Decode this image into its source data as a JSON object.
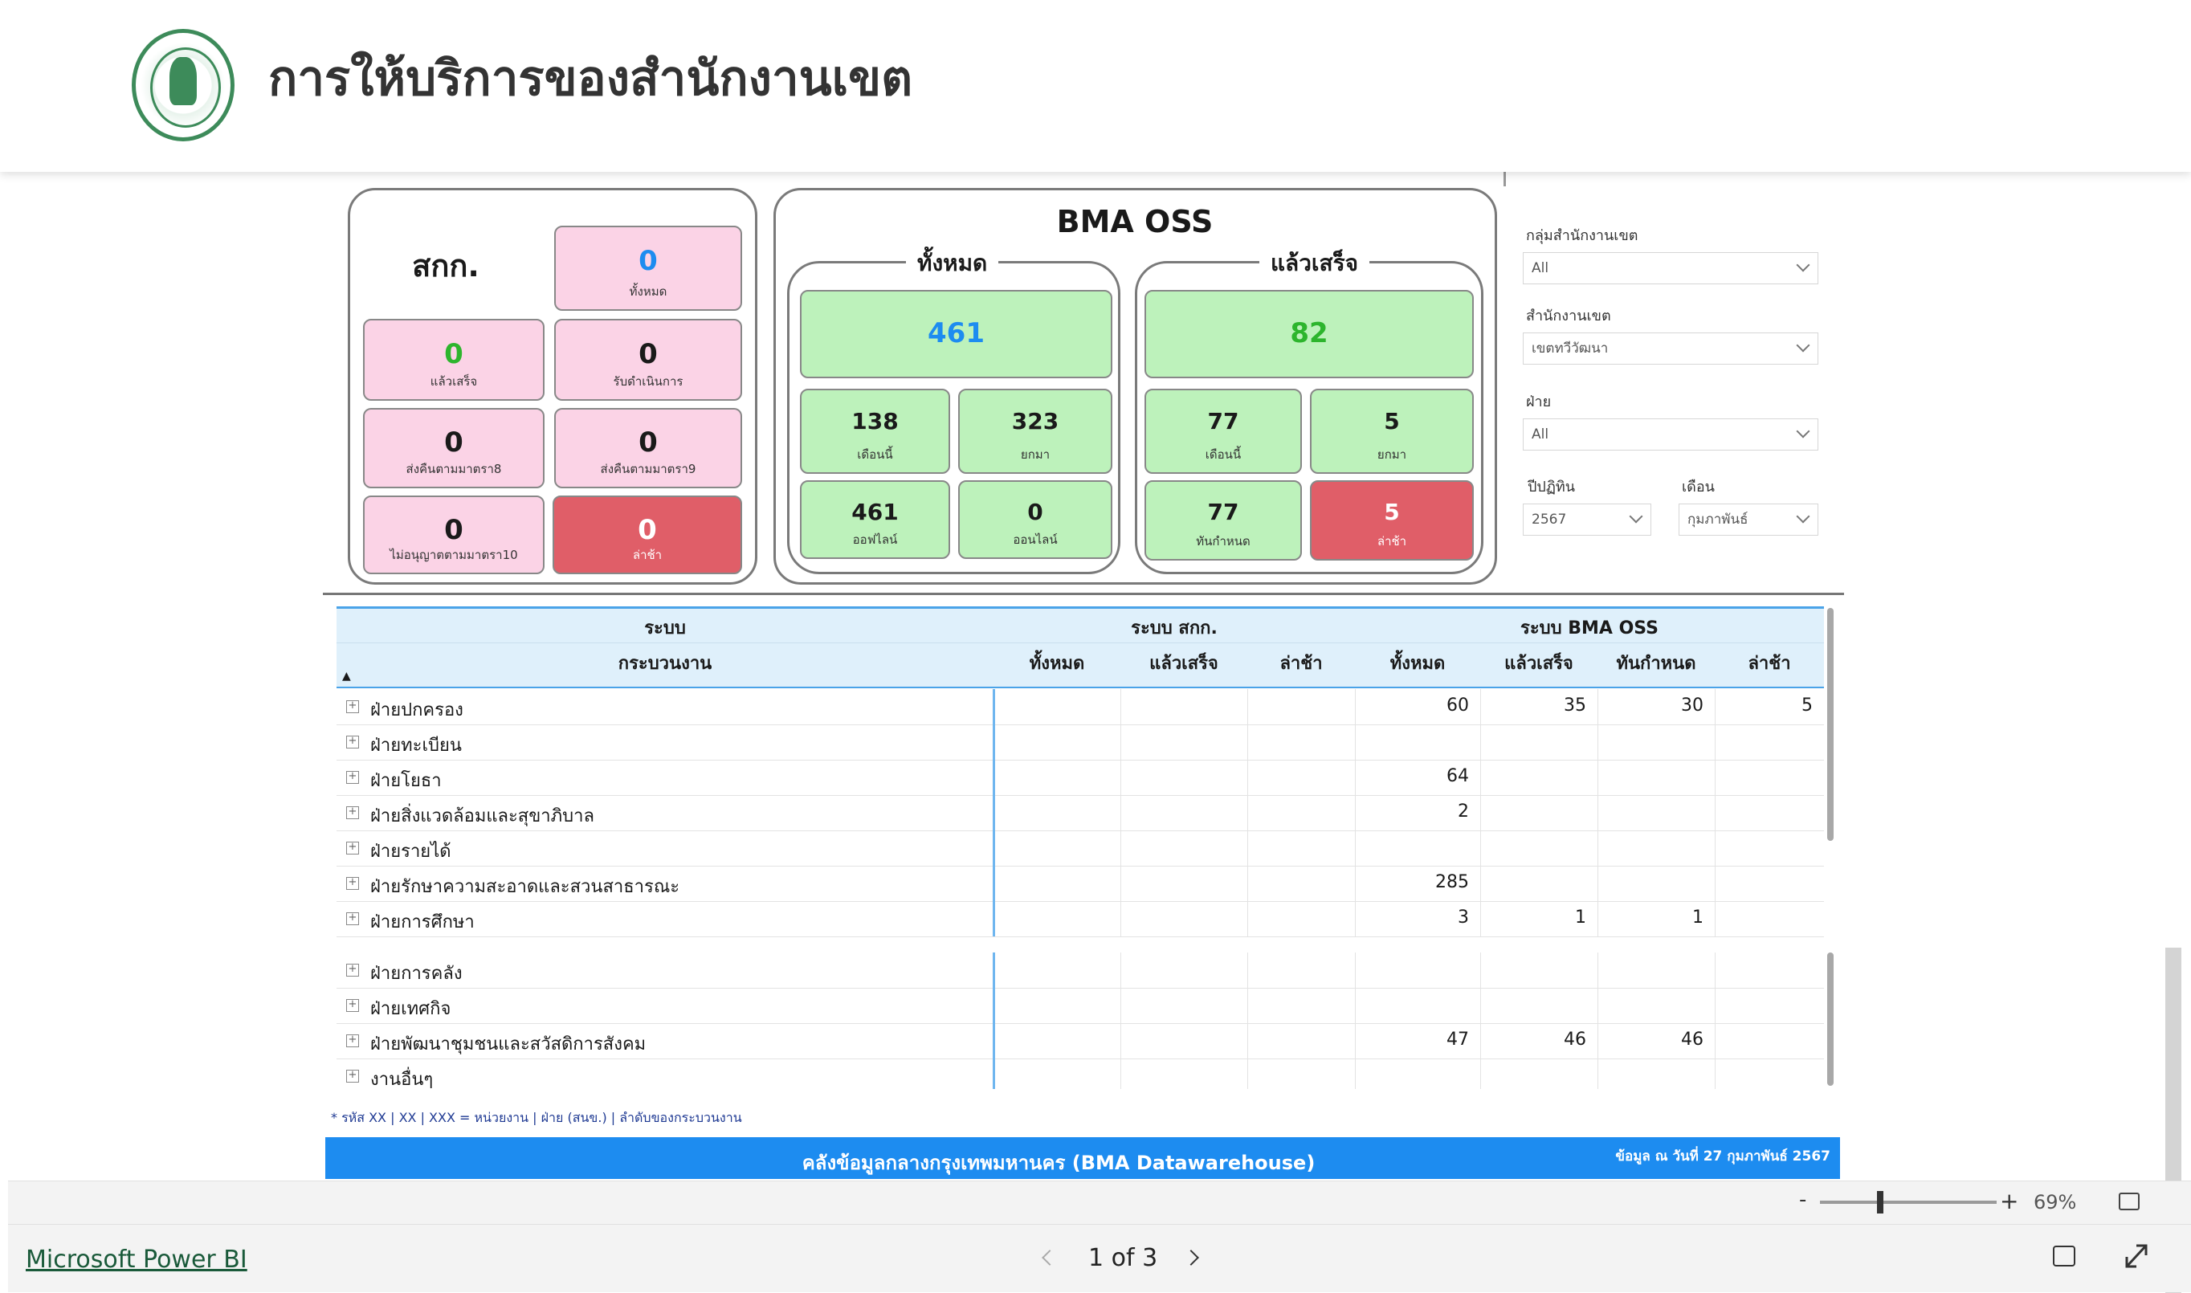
{
  "header": {
    "title": "การให้บริการของสำนักงานเขต"
  },
  "year_fragment": "2567",
  "left_panel": {
    "title": "สกก.",
    "cards": [
      {
        "value": "0",
        "label": "ทั้งหมด",
        "color": "#1d8cf0"
      },
      {
        "value": "0",
        "label": "แล้วเสร็จ",
        "color": "#2db52d"
      },
      {
        "value": "0",
        "label": "รับดำเนินการ",
        "color": "#000000"
      },
      {
        "value": "0",
        "label": "ส่งคืนตามมาตรา8",
        "color": "#000000"
      },
      {
        "value": "0",
        "label": "ส่งคืนตามมาตรา9",
        "color": "#000000"
      },
      {
        "value": "0",
        "label": "ไม่อนุญาตตามมาตรา10",
        "color": "#000000"
      },
      {
        "value": "0",
        "label": "ล่าช้า",
        "color": "#ffffff"
      }
    ]
  },
  "oss_panel": {
    "title": "BMA OSS",
    "total": {
      "title": "ทั้งหมด",
      "main_value": "461",
      "main_color": "#1d8cf0",
      "cards": [
        {
          "value": "138",
          "label": "เดือนนี้"
        },
        {
          "value": "323",
          "label": "ยกมา"
        },
        {
          "value": "461",
          "label": "ออฟไลน์"
        },
        {
          "value": "0",
          "label": "ออนไลน์"
        }
      ]
    },
    "done": {
      "title": "แล้วเสร็จ",
      "main_value": "82",
      "main_color": "#2db52d",
      "cards": [
        {
          "value": "77",
          "label": "เดือนนี้"
        },
        {
          "value": "5",
          "label": "ยกมา"
        },
        {
          "value": "77",
          "label": "ทันกำหนด"
        },
        {
          "value": "5",
          "label": "ล่าช้า"
        }
      ]
    }
  },
  "filters": {
    "group_label": "กลุ่มสำนักงานเขต",
    "group_value": "All",
    "office_label": "สำนักงานเขต",
    "office_value": "เขตทวีวัฒนา",
    "division_label": "ฝ่าย",
    "division_value": "All",
    "fy_label": "ปีปฏิทิน",
    "fy_value": "2567",
    "month_label": "เดือน",
    "month_value": "กุมภาพันธ์"
  },
  "table": {
    "group_system": "ระบบ",
    "group_skk": "ระบบ สกก.",
    "group_oss": "ระบบ BMA OSS",
    "col_process": "กระบวนงาน",
    "col_skk_total": "ทั้งหมด",
    "col_skk_done": "แล้วเสร็จ",
    "col_skk_late": "ล่าช้า",
    "col_oss_total": "ทั้งหมด",
    "col_oss_done": "แล้วเสร็จ",
    "col_oss_ontime": "ทันกำหนด",
    "col_oss_late": "ล่าช้า",
    "sort_indicator": "▲",
    "rows_top": [
      {
        "name": "ฝ่ายปกครอง",
        "oss_total": "60",
        "oss_done": "35",
        "oss_ontime": "30",
        "oss_late": "5"
      },
      {
        "name": "ฝ่ายทะเบียน",
        "oss_total": "",
        "oss_done": "",
        "oss_ontime": "",
        "oss_late": ""
      },
      {
        "name": "ฝ่ายโยธา",
        "oss_total": "64",
        "oss_done": "",
        "oss_ontime": "",
        "oss_late": ""
      },
      {
        "name": "ฝ่ายสิ่งแวดล้อมและสุขาภิบาล",
        "oss_total": "2",
        "oss_done": "",
        "oss_ontime": "",
        "oss_late": ""
      },
      {
        "name": "ฝ่ายรายได้",
        "oss_total": "",
        "oss_done": "",
        "oss_ontime": "",
        "oss_late": ""
      },
      {
        "name": "ฝ่ายรักษาความสะอาดและสวนสาธารณะ",
        "oss_total": "285",
        "oss_done": "",
        "oss_ontime": "",
        "oss_late": ""
      },
      {
        "name": "ฝ่ายการศึกษา",
        "oss_total": "3",
        "oss_done": "1",
        "oss_ontime": "1",
        "oss_late": ""
      }
    ],
    "rows_bottom": [
      {
        "name": "ฝ่ายการคลัง",
        "oss_total": "",
        "oss_done": "",
        "oss_ontime": "",
        "oss_late": ""
      },
      {
        "name": "ฝ่ายเทศกิจ",
        "oss_total": "",
        "oss_done": "",
        "oss_ontime": "",
        "oss_late": ""
      },
      {
        "name": "ฝ่ายพัฒนาชุมชนและสวัสดิการสังคม",
        "oss_total": "47",
        "oss_done": "46",
        "oss_ontime": "46",
        "oss_late": ""
      },
      {
        "name": "งานอื่นๆ",
        "oss_total": "",
        "oss_done": "",
        "oss_ontime": "",
        "oss_late": ""
      }
    ],
    "footnote": "* รหัส XX | XX | XXX = หน่วยงาน | ฝ่าย (สนข.) | ลำดับของกระบวนงาน"
  },
  "footer": {
    "title": "คลังข้อมูลกลางกรุงเทพมหานคร (BMA Datawarehouse)",
    "date": "ข้อมูล ณ วันที่ 27 กุมภาพันธ์ 2567"
  },
  "zoom": {
    "minus": "-",
    "plus": "+",
    "level": "69%",
    "level_fraction": 0.34
  },
  "powerbi": {
    "link": "Microsoft Power BI",
    "page_indicator": "1 of 3"
  },
  "colors": {
    "accent": "#1d8cf0",
    "pink": "#fbd3e6",
    "green": "#bdf2bb",
    "red": "#e05e68",
    "header_bg": "#dff0fb"
  }
}
